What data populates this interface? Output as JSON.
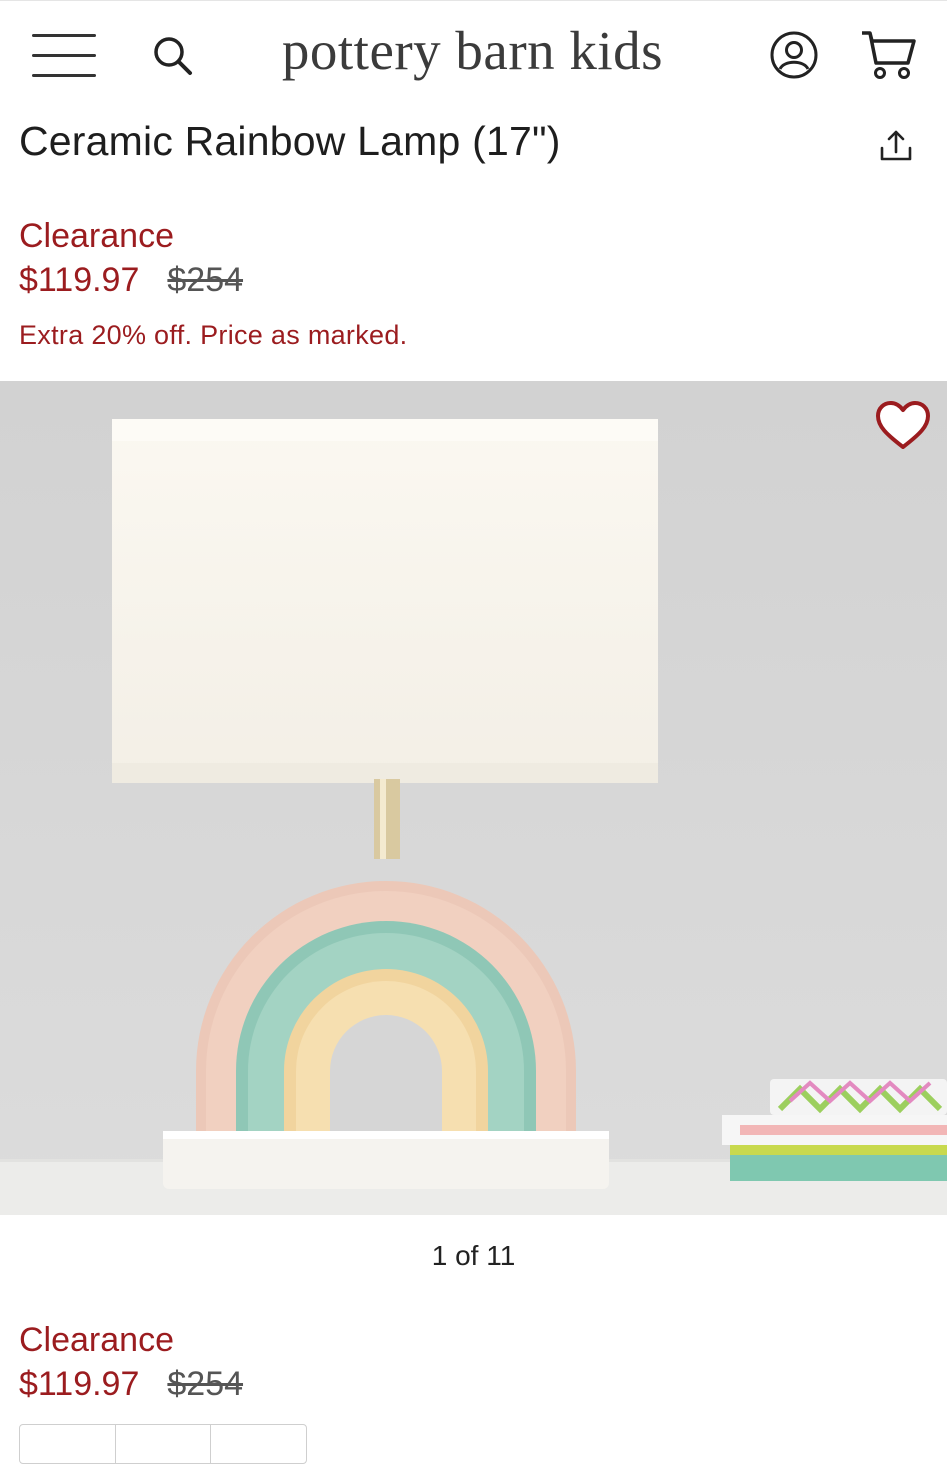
{
  "header": {
    "logo_text": "pottery barn kids",
    "menu_icon": "hamburger-menu-icon",
    "search_icon": "search-icon",
    "account_icon": "account-icon",
    "cart_icon": "cart-icon"
  },
  "product": {
    "title": "Ceramic Rainbow Lamp (17\")",
    "share_icon": "share-icon",
    "clearance_label": "Clearance",
    "sale_price": "$119.97",
    "original_price": "$254",
    "promo_text": "Extra 20% off. Price as marked.",
    "favorite_icon": "heart-icon"
  },
  "gallery": {
    "counter": "1 of 11",
    "current_index": 1,
    "total": 11
  },
  "purchase": {
    "clearance_label": "Clearance",
    "sale_price": "$119.97",
    "original_price": "$254"
  },
  "colors": {
    "accent_red": "#9b1c1f",
    "text_dark": "#1e1e1e",
    "hero_bg": "#d8d8d8"
  }
}
